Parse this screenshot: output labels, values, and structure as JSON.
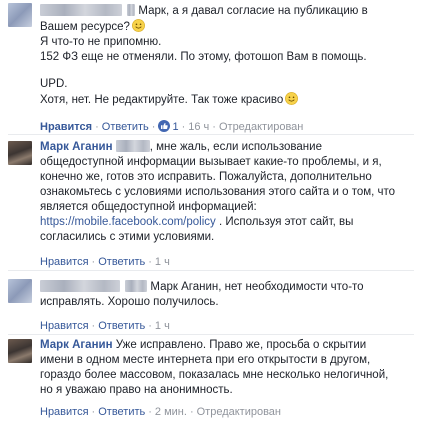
{
  "comments": [
    {
      "author": "",
      "lines": [
        "Марк, а я давал согласие на публикацию в",
        "Вашем ресурсе?",
        "Я что-то не припомню.",
        "152 ФЗ еще не отменяли. По этому, фотошоп Вам в помощь.",
        "UPD.",
        "Хотя, нет. Не редактируйте. Так тоже красиво"
      ],
      "like_label": "Нравится",
      "reply_label": "Ответить",
      "like_count": "1",
      "time": "16 ч",
      "edited_label": "Отредактирован"
    },
    {
      "author": "Марк Аганин",
      "lines": [
        ", мне жаль, если использование",
        "общедоступной информации вызывает какие-то проблемы, и я,",
        "конечно же, готов это исправить. Пожалуйста, дополнительно",
        "ознакомьтесь с условиями использования этого сайта и о том, что",
        "является общедоступной информацией:",
        "https://mobile.facebook.com/policy",
        ". Используя этот сайт, вы",
        "согласились с этими условиями."
      ],
      "like_label": "Нравится",
      "reply_label": "Ответить",
      "time": "1 ч"
    },
    {
      "author": "",
      "lines": [
        "Марк Аганин, нет необходимости что-то",
        "исправлять. Хорошо получилось."
      ],
      "like_label": "Нравится",
      "reply_label": "Ответить",
      "time": "1 ч"
    },
    {
      "author": "Марк Аганин",
      "lines": [
        "Уже исправлено. Право же, просьба о скрытии",
        "имени в одном месте интернета при его открытости в другом,",
        "гораздо более массовом, показалась мне несколько нелогичной,",
        "но я уважаю право на анонимность."
      ],
      "like_label": "Нравится",
      "reply_label": "Ответить",
      "time": "2 мин.",
      "edited_label": "Отредактирован"
    }
  ],
  "colors": {
    "link": "#365899",
    "meta": "#90949c",
    "like_blue": "#4267b2",
    "smiley": "#f7d24a"
  }
}
